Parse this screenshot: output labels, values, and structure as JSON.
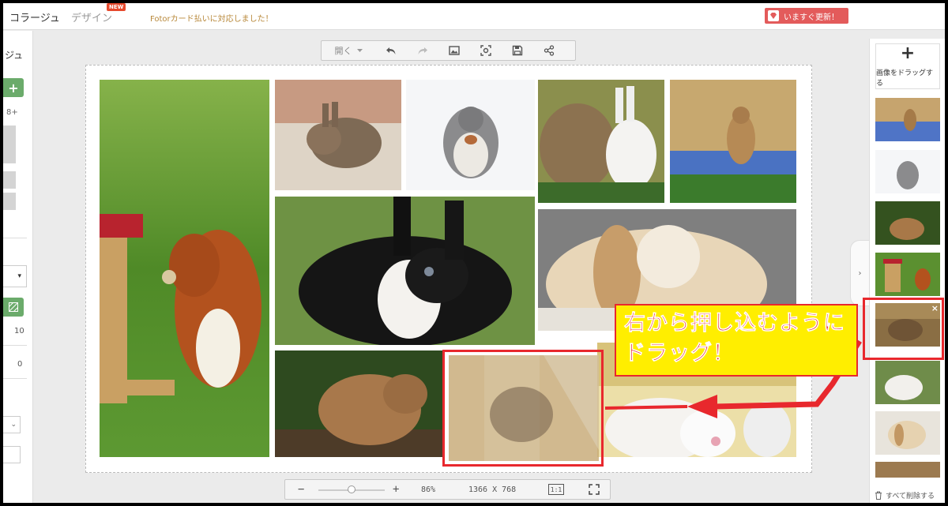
{
  "header": {
    "tab_collage": "コラージュ",
    "tab_design": "デザイン",
    "badge_new": "NEW",
    "notice": "Fotorカード払いに対応しました！",
    "update_button": "いますぐ更新！"
  },
  "left_panel": {
    "title": "ジュ",
    "add_label": "+",
    "count_label": "8+",
    "dropdown_arrow": "▾",
    "value_1": "10",
    "value_2": "0"
  },
  "toolbar": {
    "open_label": "開く",
    "icons": [
      "undo-icon",
      "redo-icon",
      "image-icon",
      "screenshot-icon",
      "save-icon",
      "share-icon"
    ]
  },
  "zoom": {
    "minus": "−",
    "plus": "+",
    "percent": "86%",
    "dimensions": "1366 X 768",
    "one_to_one": "1:1",
    "level": 0.5
  },
  "right_panel": {
    "toggle_arrow": "›",
    "add_plus": "+",
    "drag_label": "画像をドラッグする",
    "close": "×",
    "clear_all": "すべて削除する"
  },
  "annotation": {
    "text": "右から押し込むように\nドラッグ！"
  },
  "colors": {
    "accent_green": "#6bab6b",
    "update_red": "#e35b5b",
    "annotation_red": "#e8282d",
    "annotation_yellow": "#ffee00"
  }
}
